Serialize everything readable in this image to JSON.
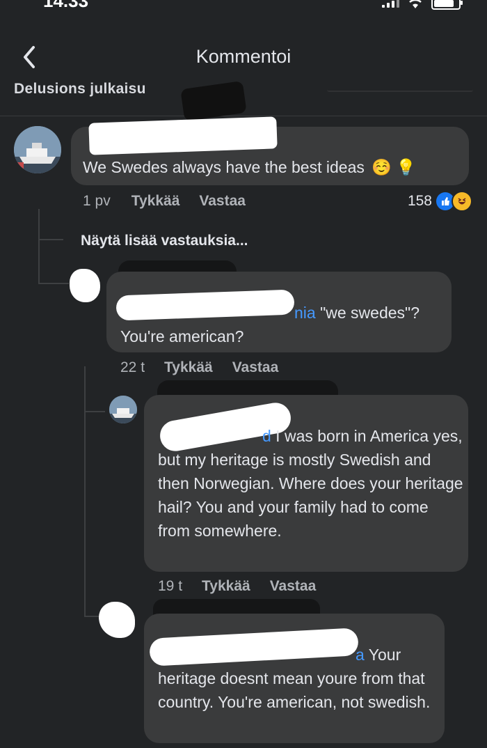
{
  "status": {
    "time": "14.33"
  },
  "header": {
    "title": "Kommentoi",
    "post_title": "Delusions julkaisu"
  },
  "comments": [
    {
      "text": "We Swedes always have the best ideas",
      "emoji": "☺️ 💡",
      "time": "1 pv",
      "like": "Tykkää",
      "reply": "Vastaa",
      "reactions": "158"
    },
    {
      "mention": "nia",
      "text": " \"we swedes\"? You're american?",
      "time": "22 t",
      "like": "Tykkää",
      "reply": "Vastaa"
    },
    {
      "mention": "d",
      "text": " I was born in America yes, but my heritage is mostly Swedish and then Norwegian. Where does your heritage hail? You and your family had to come from somewhere.",
      "time": "19 t",
      "like": "Tykkää",
      "reply": "Vastaa"
    },
    {
      "mention": "a",
      "text": " Your heritage doesnt mean youre from that country. You're american, not swedish."
    }
  ],
  "more_replies": "Näytä lisää vastauksia..."
}
